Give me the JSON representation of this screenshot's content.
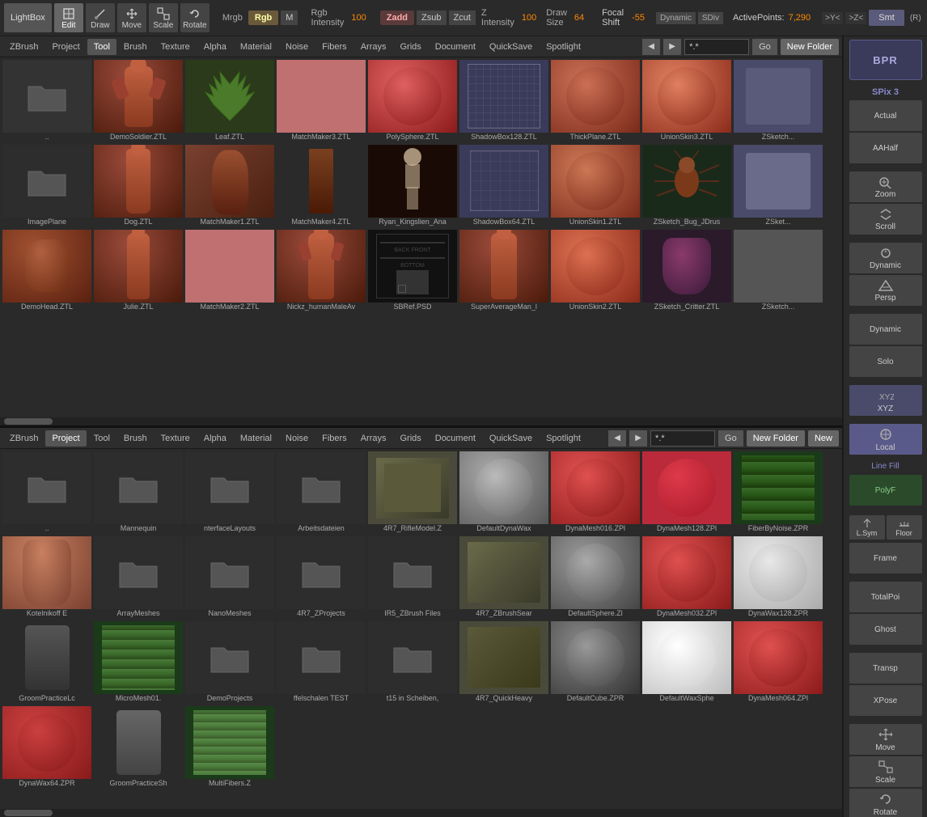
{
  "topToolbar": {
    "lightbox": "LightBox",
    "tools": [
      "Edit",
      "Draw",
      "Move",
      "Scale",
      "Rotate"
    ],
    "activeTools": [
      "Edit"
    ],
    "mrgb": "Mrgb",
    "rgb": "Rgb",
    "m": "M",
    "rgbLabel": "Rgb  Intensity",
    "rgbValue": "100",
    "zadd": "Zadd",
    "zsub": "Zsub",
    "zcut": "Zcut",
    "zIntensityLabel": "Z Intensity",
    "zIntensityValue": "100",
    "drawSizeLabel": "Draw  Size",
    "drawSizeValue": "64",
    "focalShiftLabel": "Focal  Shift",
    "focalShiftValue": "-55",
    "dynamicLabel": "Dynamic",
    "sdivLabel": "SDiv",
    "activePointsLabel": "ActivePoints:",
    "activePointsValue": "7,290",
    "axisLabels": [
      ">Y<",
      ">Z<"
    ],
    "smtLabel": "Smt",
    "rLabel": "(R)"
  },
  "topMenuBar": {
    "items": [
      "ZBrush",
      "Project",
      "Tool",
      "Brush",
      "Texture",
      "Alpha",
      "Material",
      "Noise",
      "Fibers",
      "Arrays",
      "Grids",
      "Document",
      "QuickSave",
      "Spotlight"
    ],
    "activeItem": "Tool",
    "searchPlaceholder": "*.*",
    "goButton": "Go",
    "newFolderButton": "New  Folder"
  },
  "bottomMenuBar": {
    "items": [
      "ZBrush",
      "Project",
      "Tool",
      "Brush",
      "Texture",
      "Alpha",
      "Material",
      "Noise",
      "Fibers",
      "Arrays",
      "Grids",
      "Document",
      "QuickSave",
      "Spotlight"
    ],
    "activeItem": "Project",
    "searchPlaceholder": "*.*",
    "goButton": "Go",
    "newFolderButton": "New Folder",
    "newButton": "New"
  },
  "topBrowserItems": [
    {
      "label": "..",
      "type": "folder"
    },
    {
      "label": "DemoSoldier.ZTL",
      "type": "red-figure"
    },
    {
      "label": "Leaf.ZTL",
      "type": "green-plant"
    },
    {
      "label": "MatchMaker3.ZTL",
      "type": "pink-flat"
    },
    {
      "label": "PolySphere.ZTL",
      "type": "red-sphere"
    },
    {
      "label": "ShadowBox128.ZTL",
      "type": "grid"
    },
    {
      "label": "ThickPlane.ZTL",
      "type": "dark-sphere"
    },
    {
      "label": "UnionSkin3.ZTL",
      "type": "red-sphere-2"
    },
    {
      "label": "ZSketch...",
      "type": "gray-shape"
    },
    {
      "label": "ImagePlane",
      "type": "folder"
    },
    {
      "label": "Dog.ZTL",
      "type": "dog-figure"
    },
    {
      "label": "MatchMaker1.ZTL",
      "type": "ring"
    },
    {
      "label": "MatchMaker4.ZTL",
      "type": "dark-bar"
    },
    {
      "label": "Ryan_Kingslien_Ana",
      "type": "skeleton"
    },
    {
      "label": "ShadowBox64.ZTL",
      "type": "grid-small"
    },
    {
      "label": "UnionSkin1.ZTL",
      "type": "sphere-brown"
    },
    {
      "label": "ZSketch_Bug_JDrus",
      "type": "bug"
    },
    {
      "label": "ZSket...",
      "type": "gray-shape2"
    },
    {
      "label": "DemoHead.ZTL",
      "type": "head"
    },
    {
      "label": "Julie.ZTL",
      "type": "female-figure"
    },
    {
      "label": "MatchMaker2.ZTL",
      "type": "pink-flat"
    },
    {
      "label": "Nickz_humanMaleAv",
      "type": "male-figure"
    },
    {
      "label": "SBRef.PSD",
      "type": "sbref"
    },
    {
      "label": "SuperAverageMan_l",
      "type": "male-figure2"
    },
    {
      "label": "UnionSkin2.ZTL",
      "type": "sphere-orange"
    },
    {
      "label": "ZSketch_Critter.ZTL",
      "type": "creature"
    },
    {
      "label": "ZSketch...",
      "type": "gray-shape3"
    }
  ],
  "bottomBrowserItems": [
    {
      "label": "..",
      "type": "folder"
    },
    {
      "label": "Mannequin",
      "type": "folder"
    },
    {
      "label": "nterfaceLayouts",
      "type": "folder"
    },
    {
      "label": "Arbeitsdateien",
      "type": "folder"
    },
    {
      "label": "4R7_RifleModel.Z",
      "type": "military"
    },
    {
      "label": "DefaultDynaWax",
      "type": "gray-sphere"
    },
    {
      "label": "DynaMesh016.ZPl",
      "type": "red-sphere"
    },
    {
      "label": "DynaMesh128.ZPl",
      "type": "red-sphere"
    },
    {
      "label": "FiberByNoise.ZPR",
      "type": "grass"
    },
    {
      "label": "Kotelnikoff E",
      "type": "character"
    },
    {
      "label": "ArrayMeshes",
      "type": "folder"
    },
    {
      "label": "NanoMeshes",
      "type": "folder"
    },
    {
      "label": "4R7_ZProjects",
      "type": "folder"
    },
    {
      "label": "IR5_ZBrush Files",
      "type": "folder"
    },
    {
      "label": "4R7_ZBrushSear",
      "type": "military2"
    },
    {
      "label": "DefaultSphere.Zl",
      "type": "gray-sphere2"
    },
    {
      "label": "DynaMesh032.ZPl",
      "type": "red-sphere2"
    },
    {
      "label": "DynaWax128.ZPR",
      "type": "white-sphere"
    },
    {
      "label": "GroomPracticeLc",
      "type": "animal"
    },
    {
      "label": "MicroMesh01.",
      "type": "grass2"
    },
    {
      "label": "DemoProjects",
      "type": "folder"
    },
    {
      "label": "ffelschalen TEST",
      "type": "folder"
    },
    {
      "label": "t15 in Scheiben,",
      "type": "folder"
    },
    {
      "label": "4R7_QuickHeavy",
      "type": "military3"
    },
    {
      "label": "DefaultCube.ZPR",
      "type": "gray-dark"
    },
    {
      "label": "DefaultWaxSphe",
      "type": "white-sphere2"
    },
    {
      "label": "DynaMesh064.ZPl",
      "type": "red-sphere3"
    },
    {
      "label": "DynaWax64.ZPR",
      "type": "red-wax"
    },
    {
      "label": "GroomPracticeSh",
      "type": "animal2"
    },
    {
      "label": "MultiFibers.Z",
      "type": "grass3"
    }
  ],
  "rightSidebar": {
    "bprLabel": "BPR",
    "spixLabel": "SPix 3",
    "actualLabel": "Actual",
    "aaHalfLabel": "AAHalf",
    "zoomLabel": "Zoom",
    "scrollLabel": "Scroll",
    "dynamicLabel": "Dynamic",
    "perspLabel": "Persp",
    "dynamicLabel2": "Dynamic",
    "soloLabel": "Solo",
    "xyzLabel": "XYZ",
    "localLabel": "Local",
    "lineFillLabel": "Line Fill",
    "polyFLabel": "PolyF",
    "lSymLabel": "L.Sym",
    "floorLabel": "Floor",
    "frameLabel": "Frame",
    "totalPoiLabel": "TotalPoi",
    "ghostLabel": "Ghost",
    "transpLabel": "Transp",
    "xposeLabel": "XPose",
    "moveLabel": "Move",
    "scaleLabel": "Scale",
    "rotateLabel": "Rotate"
  }
}
